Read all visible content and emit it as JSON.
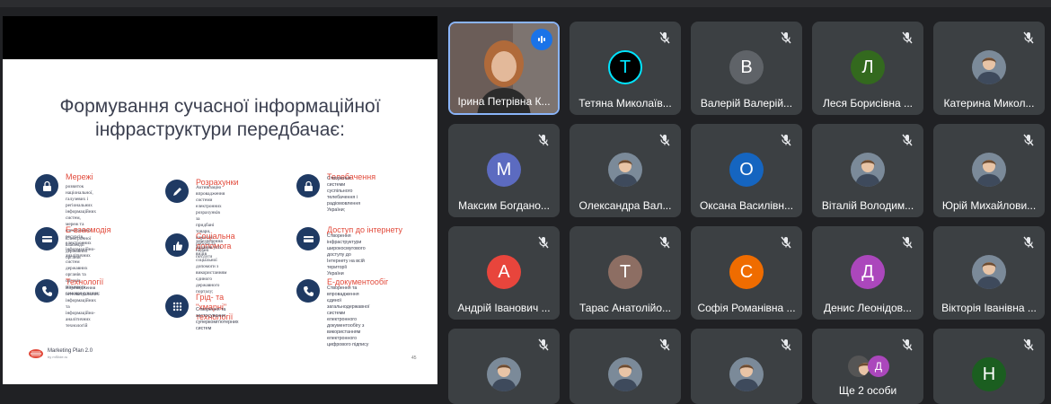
{
  "slide": {
    "title_line1": "Формування сучасної інформаційної",
    "title_line2": "інфраструктури передбачає:",
    "categories": [
      {
        "title": "Мережі",
        "description": "розвиток національної, галузевих і\nрегіональних інформаційних систем,\nмереж та електронних ресурсів,\nелектронних інформаційно-аналітичних\nсистем державних органів та органів\nмісцевого самоврядування;",
        "icon": "lock-icon"
      },
      {
        "title": "Розрахунки",
        "description": "Активізацію впровадження системи\nелектронних розрахунків за\nпридбані товари, виконані роботи та\nнадані послуги",
        "icon": "pen-icon"
      },
      {
        "title": "Телебачення",
        "description": "Створення системи суспільного\nтелебачення і радіомовлення\nУкраїни;",
        "icon": "lock-icon"
      },
      {
        "title": "Е-взаємодія",
        "description": "Електронної взаємодії державних\nорганів",
        "icon": "card-icon"
      },
      {
        "title": "Соціальна допомога",
        "description": "забезпечення надання усіх видів\nсоціальної допомоги з використанням\nєдиного державного порталу;",
        "icon": "thumb-icon"
      },
      {
        "title": "Доступ до інтернету",
        "description": "Створення інфраструктури\nширокосмугового доступу до\nІнтернету на всій території\nУкраїни",
        "icon": "card-icon"
      },
      {
        "title": "Технології",
        "description": "Впровадження інтелектуальних\nінформаційних та\nінформаційно-аналітичних\nтехнологій",
        "icon": "phone-icon"
      },
      {
        "title": "Грід- та \"хмарні\" технології",
        "description": "Створення та застосування\nсуперкомп'ютерних систем",
        "icon": "grid-icon"
      },
      {
        "title": "Е-документообіг",
        "description": "Створення та впровадження\nєдиної загальнодержавної\nсистеми електронного\nдокументообігу з використанням\nелектронного цифрового підпису",
        "icon": "phone-icon"
      }
    ],
    "footer_brand": "Marketing Plan 2.0",
    "footer_by": "by mSlide.ru",
    "page_number": "45"
  },
  "participants": [
    {
      "name": "Ірина Петрівна К...",
      "initial": "",
      "color": "",
      "photo": true,
      "speaking": true
    },
    {
      "name": "Тетяна Миколаїв...",
      "initial": "T",
      "color": "#000000",
      "photo": false,
      "speaking": false
    },
    {
      "name": "Валерій Валерій...",
      "initial": "В",
      "color": "#5f6368",
      "photo": false,
      "speaking": false
    },
    {
      "name": "Леся Борисівна ...",
      "initial": "Л",
      "color": "#33691e",
      "photo": false,
      "speaking": false
    },
    {
      "name": "Катерина Микол...",
      "initial": "",
      "color": "",
      "photo": true,
      "speaking": false
    },
    {
      "name": "Максим Богдано...",
      "initial": "М",
      "color": "#5c6bc0",
      "photo": false,
      "speaking": false
    },
    {
      "name": "Олександра Вал...",
      "initial": "",
      "color": "",
      "photo": true,
      "speaking": false
    },
    {
      "name": "Оксана Василівн...",
      "initial": "О",
      "color": "#1565c0",
      "photo": false,
      "speaking": false
    },
    {
      "name": "Віталій Володим...",
      "initial": "",
      "color": "",
      "photo": true,
      "speaking": false
    },
    {
      "name": "Юрій Михайлови...",
      "initial": "",
      "color": "",
      "photo": true,
      "speaking": false
    },
    {
      "name": "Андрій Іванович ...",
      "initial": "А",
      "color": "#e8453c",
      "photo": false,
      "speaking": false
    },
    {
      "name": "Тарас Анатолійо...",
      "initial": "Т",
      "color": "#8d6e63",
      "photo": false,
      "speaking": false
    },
    {
      "name": "Софія Романівна ...",
      "initial": "С",
      "color": "#ef6c00",
      "photo": false,
      "speaking": false
    },
    {
      "name": "Денис Леонідов...",
      "initial": "Д",
      "color": "#ab47bc",
      "photo": false,
      "speaking": false
    },
    {
      "name": "Вікторія Іванівна ...",
      "initial": "",
      "color": "",
      "photo": true,
      "speaking": false
    },
    {
      "name": "",
      "initial": "",
      "color": "",
      "photo": true,
      "speaking": false
    },
    {
      "name": "",
      "initial": "",
      "color": "",
      "photo": true,
      "speaking": false
    },
    {
      "name": "",
      "initial": "",
      "color": "",
      "photo": true,
      "speaking": false
    },
    {
      "name": "Ще 2 особи",
      "initial": "Д",
      "color": "#ab47bc",
      "photo": false,
      "speaking": false,
      "group": true
    },
    {
      "name": "",
      "initial": "Н",
      "color": "#1b5e20",
      "photo": false,
      "speaking": false
    }
  ],
  "colors": {
    "background": "#202124",
    "tile": "#3c4043",
    "active_border": "#8ab4f8",
    "slide_title": "#3b3f4f",
    "slide_accent": "#e24a3b",
    "slide_icon": "#1f3a63"
  }
}
